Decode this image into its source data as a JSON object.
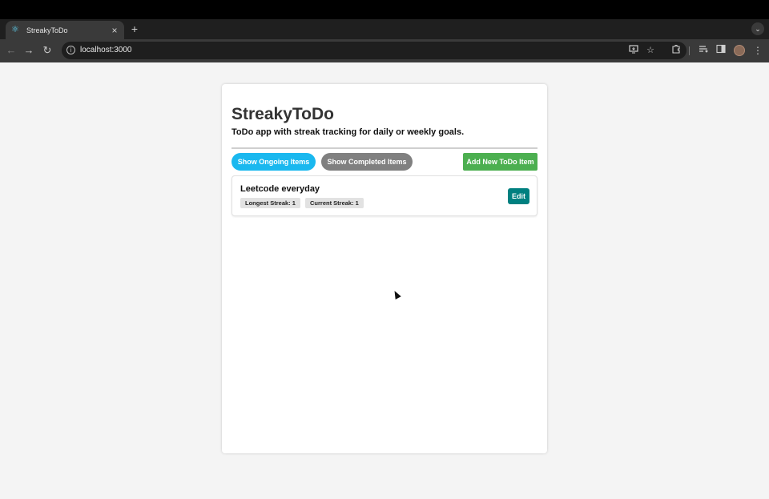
{
  "browser": {
    "tab_title": "StreakyToDo",
    "tab_favicon": "react-logo-icon",
    "tab_close": "×",
    "new_tab": "+",
    "tab_search_glyph": "⌄",
    "url": "localhost:3000",
    "nav": {
      "back": "←",
      "forward": "→",
      "reload": "↻"
    },
    "icons": [
      "install-app-icon",
      "bookmark-star-icon",
      "extensions-icon",
      "reading-list-icon",
      "side-panel-icon",
      "profile-avatar-icon",
      "menu-icon"
    ]
  },
  "app": {
    "title": "StreakyToDo",
    "subtitle": "ToDo app with streak tracking for daily or weekly goals.",
    "buttons": {
      "ongoing": "Show Ongoing Items",
      "completed": "Show Completed Items",
      "add": "Add New ToDo Item"
    },
    "todos": [
      {
        "title": "Leetcode everyday",
        "longest_streak": "Longest Streak: 1",
        "current_streak": "Current Streak: 1",
        "edit_label": "Edit"
      }
    ]
  },
  "colors": {
    "ongoing_button": "#1ab8ef",
    "completed_button": "#808080",
    "add_button": "#4caf50",
    "edit_button": "#008080"
  }
}
